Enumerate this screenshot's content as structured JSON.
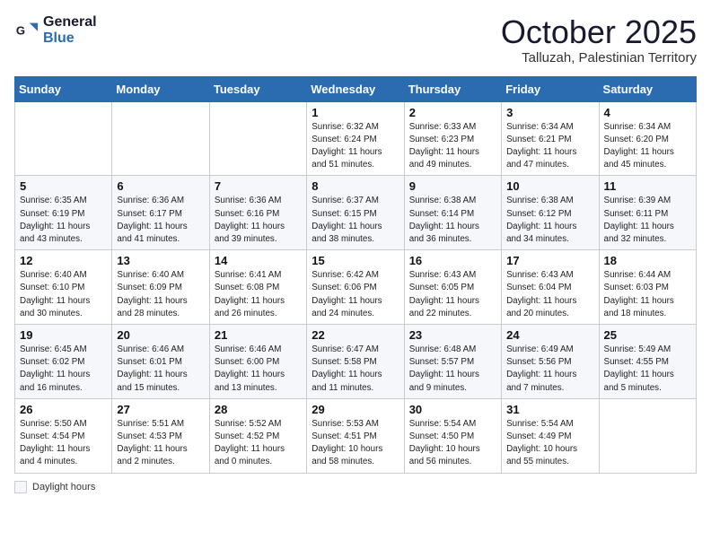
{
  "header": {
    "logo_line1": "General",
    "logo_line2": "Blue",
    "month": "October 2025",
    "location": "Talluzah, Palestinian Territory"
  },
  "weekdays": [
    "Sunday",
    "Monday",
    "Tuesday",
    "Wednesday",
    "Thursday",
    "Friday",
    "Saturday"
  ],
  "weeks": [
    [
      {
        "day": "",
        "info": ""
      },
      {
        "day": "",
        "info": ""
      },
      {
        "day": "",
        "info": ""
      },
      {
        "day": "1",
        "info": "Sunrise: 6:32 AM\nSunset: 6:24 PM\nDaylight: 11 hours\nand 51 minutes."
      },
      {
        "day": "2",
        "info": "Sunrise: 6:33 AM\nSunset: 6:23 PM\nDaylight: 11 hours\nand 49 minutes."
      },
      {
        "day": "3",
        "info": "Sunrise: 6:34 AM\nSunset: 6:21 PM\nDaylight: 11 hours\nand 47 minutes."
      },
      {
        "day": "4",
        "info": "Sunrise: 6:34 AM\nSunset: 6:20 PM\nDaylight: 11 hours\nand 45 minutes."
      }
    ],
    [
      {
        "day": "5",
        "info": "Sunrise: 6:35 AM\nSunset: 6:19 PM\nDaylight: 11 hours\nand 43 minutes."
      },
      {
        "day": "6",
        "info": "Sunrise: 6:36 AM\nSunset: 6:17 PM\nDaylight: 11 hours\nand 41 minutes."
      },
      {
        "day": "7",
        "info": "Sunrise: 6:36 AM\nSunset: 6:16 PM\nDaylight: 11 hours\nand 39 minutes."
      },
      {
        "day": "8",
        "info": "Sunrise: 6:37 AM\nSunset: 6:15 PM\nDaylight: 11 hours\nand 38 minutes."
      },
      {
        "day": "9",
        "info": "Sunrise: 6:38 AM\nSunset: 6:14 PM\nDaylight: 11 hours\nand 36 minutes."
      },
      {
        "day": "10",
        "info": "Sunrise: 6:38 AM\nSunset: 6:12 PM\nDaylight: 11 hours\nand 34 minutes."
      },
      {
        "day": "11",
        "info": "Sunrise: 6:39 AM\nSunset: 6:11 PM\nDaylight: 11 hours\nand 32 minutes."
      }
    ],
    [
      {
        "day": "12",
        "info": "Sunrise: 6:40 AM\nSunset: 6:10 PM\nDaylight: 11 hours\nand 30 minutes."
      },
      {
        "day": "13",
        "info": "Sunrise: 6:40 AM\nSunset: 6:09 PM\nDaylight: 11 hours\nand 28 minutes."
      },
      {
        "day": "14",
        "info": "Sunrise: 6:41 AM\nSunset: 6:08 PM\nDaylight: 11 hours\nand 26 minutes."
      },
      {
        "day": "15",
        "info": "Sunrise: 6:42 AM\nSunset: 6:06 PM\nDaylight: 11 hours\nand 24 minutes."
      },
      {
        "day": "16",
        "info": "Sunrise: 6:43 AM\nSunset: 6:05 PM\nDaylight: 11 hours\nand 22 minutes."
      },
      {
        "day": "17",
        "info": "Sunrise: 6:43 AM\nSunset: 6:04 PM\nDaylight: 11 hours\nand 20 minutes."
      },
      {
        "day": "18",
        "info": "Sunrise: 6:44 AM\nSunset: 6:03 PM\nDaylight: 11 hours\nand 18 minutes."
      }
    ],
    [
      {
        "day": "19",
        "info": "Sunrise: 6:45 AM\nSunset: 6:02 PM\nDaylight: 11 hours\nand 16 minutes."
      },
      {
        "day": "20",
        "info": "Sunrise: 6:46 AM\nSunset: 6:01 PM\nDaylight: 11 hours\nand 15 minutes."
      },
      {
        "day": "21",
        "info": "Sunrise: 6:46 AM\nSunset: 6:00 PM\nDaylight: 11 hours\nand 13 minutes."
      },
      {
        "day": "22",
        "info": "Sunrise: 6:47 AM\nSunset: 5:58 PM\nDaylight: 11 hours\nand 11 minutes."
      },
      {
        "day": "23",
        "info": "Sunrise: 6:48 AM\nSunset: 5:57 PM\nDaylight: 11 hours\nand 9 minutes."
      },
      {
        "day": "24",
        "info": "Sunrise: 6:49 AM\nSunset: 5:56 PM\nDaylight: 11 hours\nand 7 minutes."
      },
      {
        "day": "25",
        "info": "Sunrise: 5:49 AM\nSunset: 4:55 PM\nDaylight: 11 hours\nand 5 minutes."
      }
    ],
    [
      {
        "day": "26",
        "info": "Sunrise: 5:50 AM\nSunset: 4:54 PM\nDaylight: 11 hours\nand 4 minutes."
      },
      {
        "day": "27",
        "info": "Sunrise: 5:51 AM\nSunset: 4:53 PM\nDaylight: 11 hours\nand 2 minutes."
      },
      {
        "day": "28",
        "info": "Sunrise: 5:52 AM\nSunset: 4:52 PM\nDaylight: 11 hours\nand 0 minutes."
      },
      {
        "day": "29",
        "info": "Sunrise: 5:53 AM\nSunset: 4:51 PM\nDaylight: 10 hours\nand 58 minutes."
      },
      {
        "day": "30",
        "info": "Sunrise: 5:54 AM\nSunset: 4:50 PM\nDaylight: 10 hours\nand 56 minutes."
      },
      {
        "day": "31",
        "info": "Sunrise: 5:54 AM\nSunset: 4:49 PM\nDaylight: 10 hours\nand 55 minutes."
      },
      {
        "day": "",
        "info": ""
      }
    ]
  ],
  "footer": {
    "daylight_label": "Daylight hours"
  }
}
